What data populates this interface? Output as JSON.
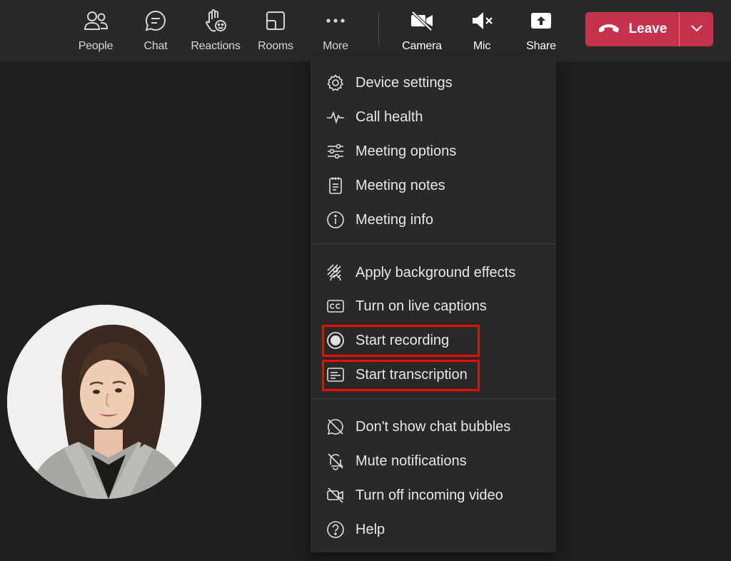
{
  "toolbar": {
    "people": "People",
    "chat": "Chat",
    "reactions": "Reactions",
    "rooms": "Rooms",
    "more": "More",
    "camera": "Camera",
    "mic": "Mic",
    "share": "Share",
    "leave": "Leave"
  },
  "menu": {
    "items": [
      {
        "label": "Device settings",
        "icon": "gear-icon"
      },
      {
        "label": "Call health",
        "icon": "pulse-icon"
      },
      {
        "label": "Meeting options",
        "icon": "sliders-icon"
      },
      {
        "label": "Meeting notes",
        "icon": "notes-icon"
      },
      {
        "label": "Meeting info",
        "icon": "info-icon"
      },
      {
        "label": "Apply background effects",
        "icon": "background-effects-icon"
      },
      {
        "label": "Turn on live captions",
        "icon": "captions-icon"
      },
      {
        "label": "Start recording",
        "icon": "record-icon"
      },
      {
        "label": "Start transcription",
        "icon": "transcript-icon"
      },
      {
        "label": "Don't show chat bubbles",
        "icon": "chat-off-icon"
      },
      {
        "label": "Mute notifications",
        "icon": "bell-off-icon"
      },
      {
        "label": "Turn off incoming video",
        "icon": "video-off-icon"
      },
      {
        "label": "Help",
        "icon": "help-icon"
      }
    ]
  },
  "colors": {
    "leave": "#c4314b",
    "highlight": "#ff0000",
    "menu_bg": "#292929",
    "stage_bg": "#1f1f1f"
  }
}
